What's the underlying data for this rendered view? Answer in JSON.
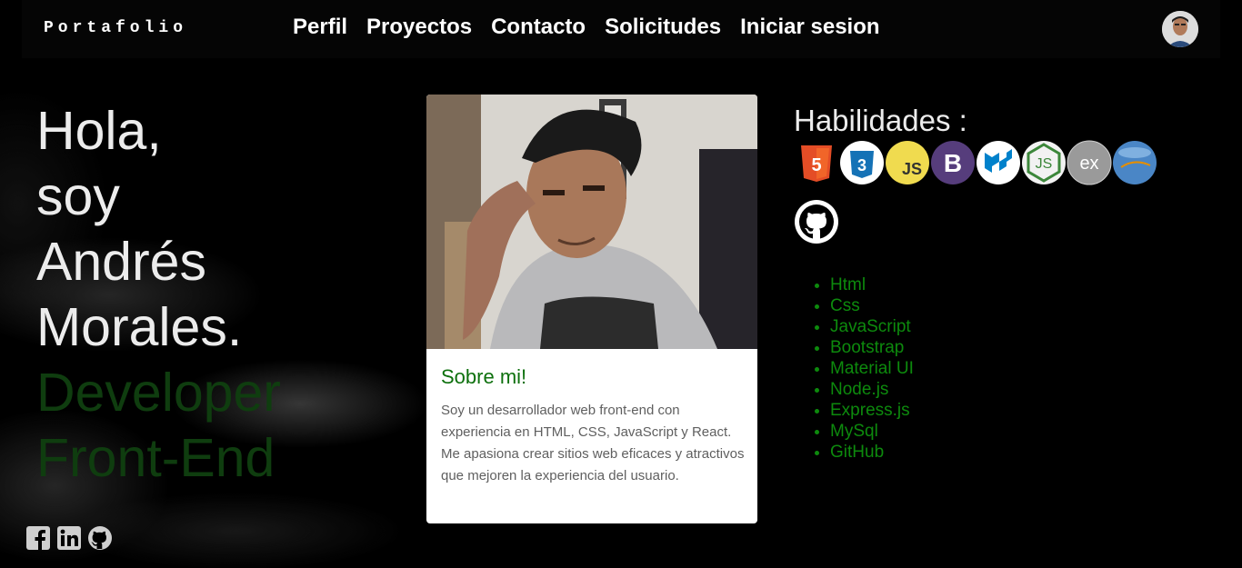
{
  "navbar": {
    "brand": "Portafolio",
    "links": [
      "Perfil",
      "Proyectos",
      "Contacto",
      "Solicitudes",
      "Iniciar sesion"
    ]
  },
  "hero": {
    "lines": [
      "Hola,",
      "soy",
      "Andrés",
      "Morales."
    ],
    "role_lines": [
      "Developer",
      "Front-End"
    ]
  },
  "about": {
    "title": "Sobre mi!",
    "text": "Soy un desarrollador web front-end con experiencia en HTML, CSS, JavaScript y React. Me apasiona crear sitios web eficaces y atractivos que mejoren la experiencia del usuario."
  },
  "skills": {
    "title": "Habilidades :",
    "items": [
      "Html",
      "Css",
      "JavaScript",
      "Bootstrap",
      "Material UI",
      "Node.js",
      "Express.js",
      "MySql",
      "GitHub"
    ],
    "icons": [
      "html5-icon",
      "css3-icon",
      "javascript-icon",
      "bootstrap-icon",
      "material-ui-icon",
      "nodejs-icon",
      "express-icon",
      "mysql-icon",
      "github-icon"
    ]
  },
  "social": [
    "facebook-icon",
    "linkedin-icon",
    "github-icon"
  ],
  "colors": {
    "background": "#000000",
    "accent_green": "#0d8a0d",
    "role_green": "#0f3d0f",
    "card_title_green": "#0d700d"
  }
}
